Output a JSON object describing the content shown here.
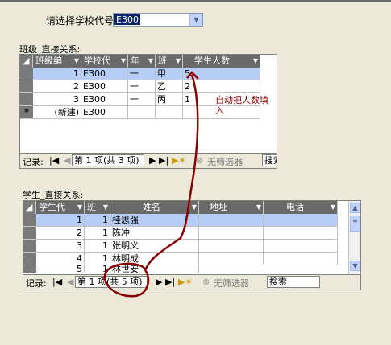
{
  "school_select": {
    "label": "请选择学校代号:",
    "value": "E300"
  },
  "subform1": {
    "title": "班级_直接关系:",
    "columns": [
      "班级编",
      "学校代",
      "年",
      "班",
      "学生人数"
    ],
    "rows": [
      {
        "id": "1",
        "school": "E300",
        "grade": "一",
        "class": "甲",
        "count": "5"
      },
      {
        "id": "2",
        "school": "E300",
        "grade": "一",
        "class": "乙",
        "count": "2"
      },
      {
        "id": "3",
        "school": "E300",
        "grade": "一",
        "class": "丙",
        "count": "1"
      }
    ],
    "new_row": {
      "marker": "*",
      "id": "(新建)",
      "school": "E300"
    },
    "nav": {
      "record_label": "记录:",
      "position": "第 1 项(共 3 项)",
      "filter": "无筛选器",
      "search": "搜索"
    }
  },
  "annotation": {
    "line1": "自动把人数填",
    "line2": "入"
  },
  "subform2": {
    "title": "学生_直接关系:",
    "columns": [
      "学生代",
      "班",
      "姓名",
      "地址",
      "电话"
    ],
    "rows": [
      {
        "sid": "1",
        "cls": "1",
        "name": "桂思强"
      },
      {
        "sid": "2",
        "cls": "1",
        "name": "陈冲"
      },
      {
        "sid": "3",
        "cls": "1",
        "name": "张明义"
      },
      {
        "sid": "4",
        "cls": "1",
        "name": "林明成"
      },
      {
        "sid": "5",
        "cls": "1",
        "name": "林世安"
      }
    ],
    "nav": {
      "record_label": "记录:",
      "position": "第 1 项(共 5 项)",
      "filter": "无筛选器",
      "search": "搜索"
    }
  },
  "colors": {
    "annotation": "#8b0000",
    "header_bg": "#696969",
    "highlight": "#b6cdf5"
  },
  "icons": [
    "chevron-down-icon",
    "first-record-icon",
    "prev-record-icon",
    "next-record-icon",
    "last-record-icon",
    "new-record-icon",
    "filter-icon",
    "scroll-up-icon",
    "scroll-down-icon"
  ]
}
